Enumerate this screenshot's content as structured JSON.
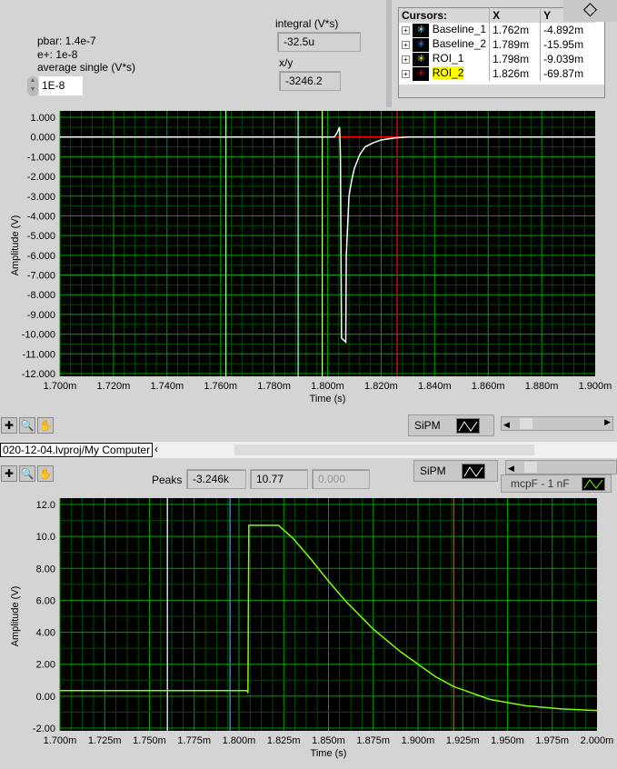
{
  "controls": {
    "pbar": "pbar: 1.4e-7",
    "eplus": "e+: 1e-8",
    "avg_label": "average single (V*s)",
    "avg_value": "1E-8",
    "integral_label": "integral (V*s)",
    "integral_value": "-32.5u",
    "xy_label": "x/y",
    "xy_value": "-3246.2"
  },
  "cursors": {
    "headers": [
      "Cursors:",
      "X",
      "Y"
    ],
    "rows": [
      {
        "name": "Baseline_1",
        "x": "1.762m",
        "y": "-4.892m",
        "color": "#80ffff"
      },
      {
        "name": "Baseline_2",
        "x": "1.789m",
        "y": "-15.95m",
        "color": "#3090ff"
      },
      {
        "name": "ROI_1",
        "x": "1.798m",
        "y": "-9.039m",
        "color": "#ffff00"
      },
      {
        "name": "ROI_2",
        "x": "1.826m",
        "y": "-69.87m",
        "color": "#ff0000",
        "highlight": "#ffff00"
      }
    ]
  },
  "top_toolbar": {
    "legend": "SiPM"
  },
  "path_bar": {
    "text": "020-12-04.lvproj/My Computer"
  },
  "bottom_toolbar": {
    "peaks_label": "Peaks",
    "peaks": [
      "-3.246k",
      "10.77",
      "0.000"
    ],
    "legend1": "SiPM",
    "legend2": "mcpF - 1 nF"
  },
  "chart_data": [
    {
      "type": "line",
      "xlabel": "Time (s)",
      "ylabel": "Amplitude (V)",
      "xlim": [
        1.7,
        1.9
      ],
      "ylim": [
        -12,
        1
      ],
      "xticks": [
        "1.700m",
        "1.720m",
        "1.740m",
        "1.760m",
        "1.780m",
        "1.800m",
        "1.820m",
        "1.840m",
        "1.860m",
        "1.880m",
        "1.900m"
      ],
      "yticks": [
        "1.000",
        "0.000",
        "-1.000",
        "-2.000",
        "-3.000",
        "-4.000",
        "-5.000",
        "-6.000",
        "-7.000",
        "-8.000",
        "-9.000",
        "-10.000",
        "-11.000",
        "-12.000"
      ],
      "grid": true,
      "background": "#000000",
      "grid_color": "#008000",
      "series_color": "#ffffff",
      "cursors": [
        {
          "x": 1.762,
          "color": "#a0ffa0"
        },
        {
          "x": 1.789,
          "color": "#80ffc0"
        },
        {
          "x": 1.798,
          "color": "#c0ff80"
        },
        {
          "x": 1.826,
          "color": "#ff0000"
        }
      ],
      "hline": {
        "y": 0,
        "color": "#ff0000"
      },
      "points": [
        [
          1.7,
          0
        ],
        [
          1.8025,
          0
        ],
        [
          1.8035,
          0.2
        ],
        [
          1.8045,
          0.5
        ],
        [
          1.8048,
          -1.0
        ],
        [
          1.8052,
          -10.2
        ],
        [
          1.8068,
          -10.4
        ],
        [
          1.807,
          -6
        ],
        [
          1.808,
          -3
        ],
        [
          1.809,
          -2.2
        ],
        [
          1.81,
          -1.6
        ],
        [
          1.812,
          -0.9
        ],
        [
          1.814,
          -0.5
        ],
        [
          1.817,
          -0.3
        ],
        [
          1.82,
          -0.15
        ],
        [
          1.825,
          -0.05
        ],
        [
          1.83,
          0
        ],
        [
          1.9,
          0
        ]
      ]
    },
    {
      "type": "line",
      "xlabel": "Time (s)",
      "ylabel": "Amplitude (V)",
      "xlim": [
        1.7,
        2.0
      ],
      "ylim": [
        -2,
        12
      ],
      "xticks": [
        "1.700m",
        "1.725m",
        "1.750m",
        "1.775m",
        "1.800m",
        "1.825m",
        "1.850m",
        "1.875m",
        "1.900m",
        "1.925m",
        "1.950m",
        "1.975m",
        "2.000m"
      ],
      "yticks": [
        "12.0",
        "10.0",
        "8.00",
        "6.00",
        "4.00",
        "2.00",
        "0.00",
        "-2.00"
      ],
      "grid": true,
      "background": "#000000",
      "grid_color": "#008000",
      "series_color": "#80ff00",
      "cursors": [
        {
          "x": 1.76,
          "color": "#e0ffff"
        },
        {
          "x": 1.795,
          "color": "#3090ff"
        },
        {
          "x": 1.92,
          "color": "#ff2020"
        }
      ],
      "points": [
        [
          1.7,
          0.35
        ],
        [
          1.8045,
          0.35
        ],
        [
          1.805,
          0.2
        ],
        [
          1.8055,
          10.7
        ],
        [
          1.822,
          10.7
        ],
        [
          1.83,
          9.9
        ],
        [
          1.84,
          8.6
        ],
        [
          1.85,
          7.2
        ],
        [
          1.86,
          5.9
        ],
        [
          1.875,
          4.2
        ],
        [
          1.89,
          2.8
        ],
        [
          1.9,
          2.0
        ],
        [
          1.91,
          1.2
        ],
        [
          1.92,
          0.6
        ],
        [
          1.94,
          -0.2
        ],
        [
          1.96,
          -0.6
        ],
        [
          1.98,
          -0.8
        ],
        [
          2.0,
          -0.9
        ]
      ]
    }
  ]
}
